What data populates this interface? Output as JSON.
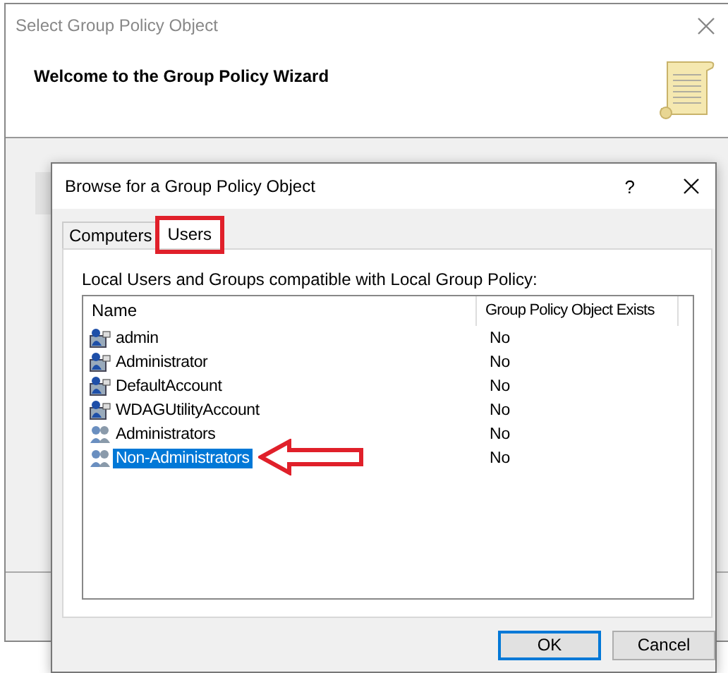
{
  "back_window": {
    "title": "Select Group Policy Object",
    "heading": "Welcome to the Group Policy Wizard"
  },
  "dialog": {
    "title": "Browse for a Group Policy Object",
    "help": "?",
    "tabs": [
      {
        "label": "Computers",
        "selected": false
      },
      {
        "label": "Users",
        "selected": true
      }
    ],
    "caption": "Local Users and Groups compatible with Local Group Policy:",
    "columns": [
      "Name",
      "Group Policy Object Exists"
    ],
    "rows": [
      {
        "kind": "user",
        "name": "admin",
        "exists": "No",
        "selected": false
      },
      {
        "kind": "user",
        "name": "Administrator",
        "exists": "No",
        "selected": false
      },
      {
        "kind": "user",
        "name": "DefaultAccount",
        "exists": "No",
        "selected": false
      },
      {
        "kind": "user",
        "name": "WDAGUtilityAccount",
        "exists": "No",
        "selected": false
      },
      {
        "kind": "group",
        "name": "Administrators",
        "exists": "No",
        "selected": false
      },
      {
        "kind": "group",
        "name": "Non-Administrators",
        "exists": "No",
        "selected": true
      }
    ],
    "buttons": [
      {
        "label": "OK",
        "default": true
      },
      {
        "label": "Cancel",
        "default": false
      }
    ]
  }
}
